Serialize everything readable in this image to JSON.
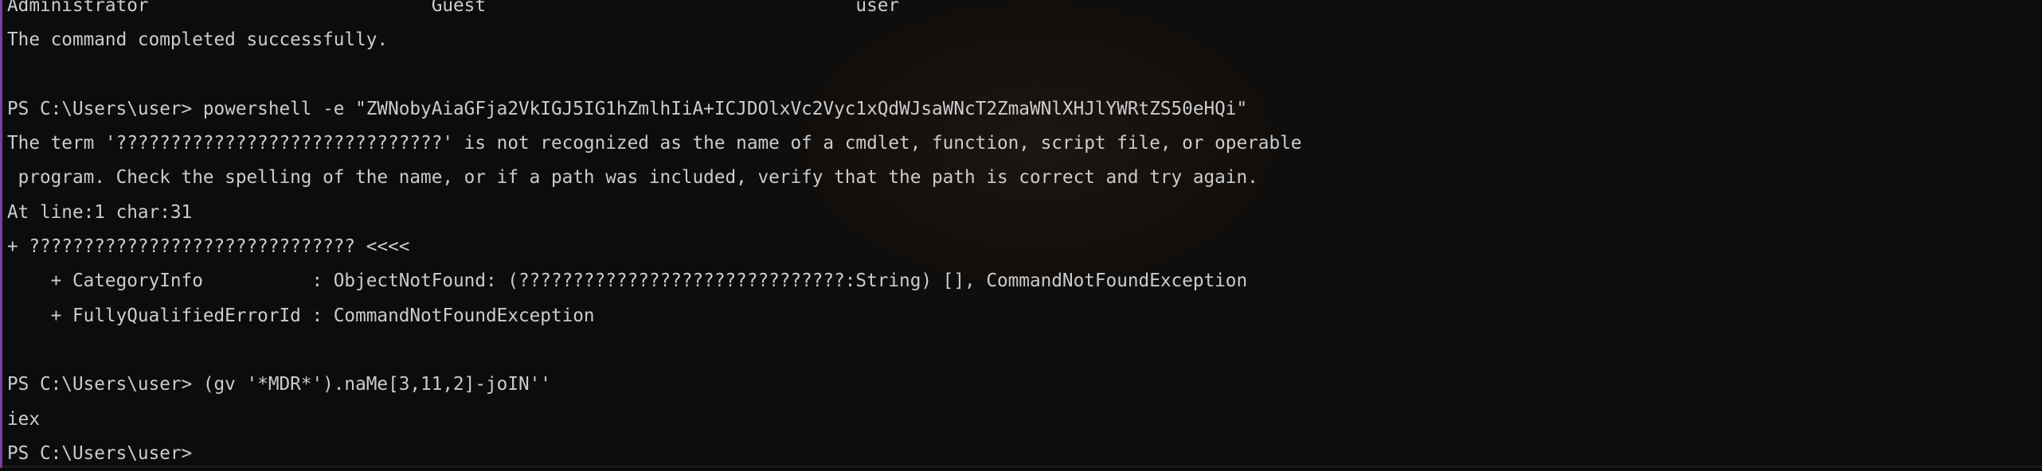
{
  "terminal": {
    "lines": [
      "Administrator                          Guest                                  user",
      "The command completed successfully.",
      "",
      "PS C:\\Users\\user> powershell -e \"ZWNobyAiaGFja2VkIGJ5IG1hZmlhIiA+ICJDOlxVc2Vyc1xQdWJsaWNcT2ZmaWNlXHJlYWRtZS50eHQi\"",
      "The term '??????????????????????????????' is not recognized as the name of a cmdlet, function, script file, or operable",
      " program. Check the spelling of the name, or if a path was included, verify that the path is correct and try again.",
      "At line:1 char:31",
      "+ ?????????????????????????????? <<<<",
      "    + CategoryInfo          : ObjectNotFound: (??????????????????????????????:String) [], CommandNotFoundException",
      "    + FullyQualifiedErrorId : CommandNotFoundException",
      "",
      "PS C:\\Users\\user> (gv '*MDR*').naMe[3,11,2]-joIN''",
      "iex",
      "PS C:\\Users\\user>"
    ]
  },
  "colors": {
    "background": "#0c0c0c",
    "text": "#cccccc",
    "accent_border": "#7a3fa0"
  }
}
